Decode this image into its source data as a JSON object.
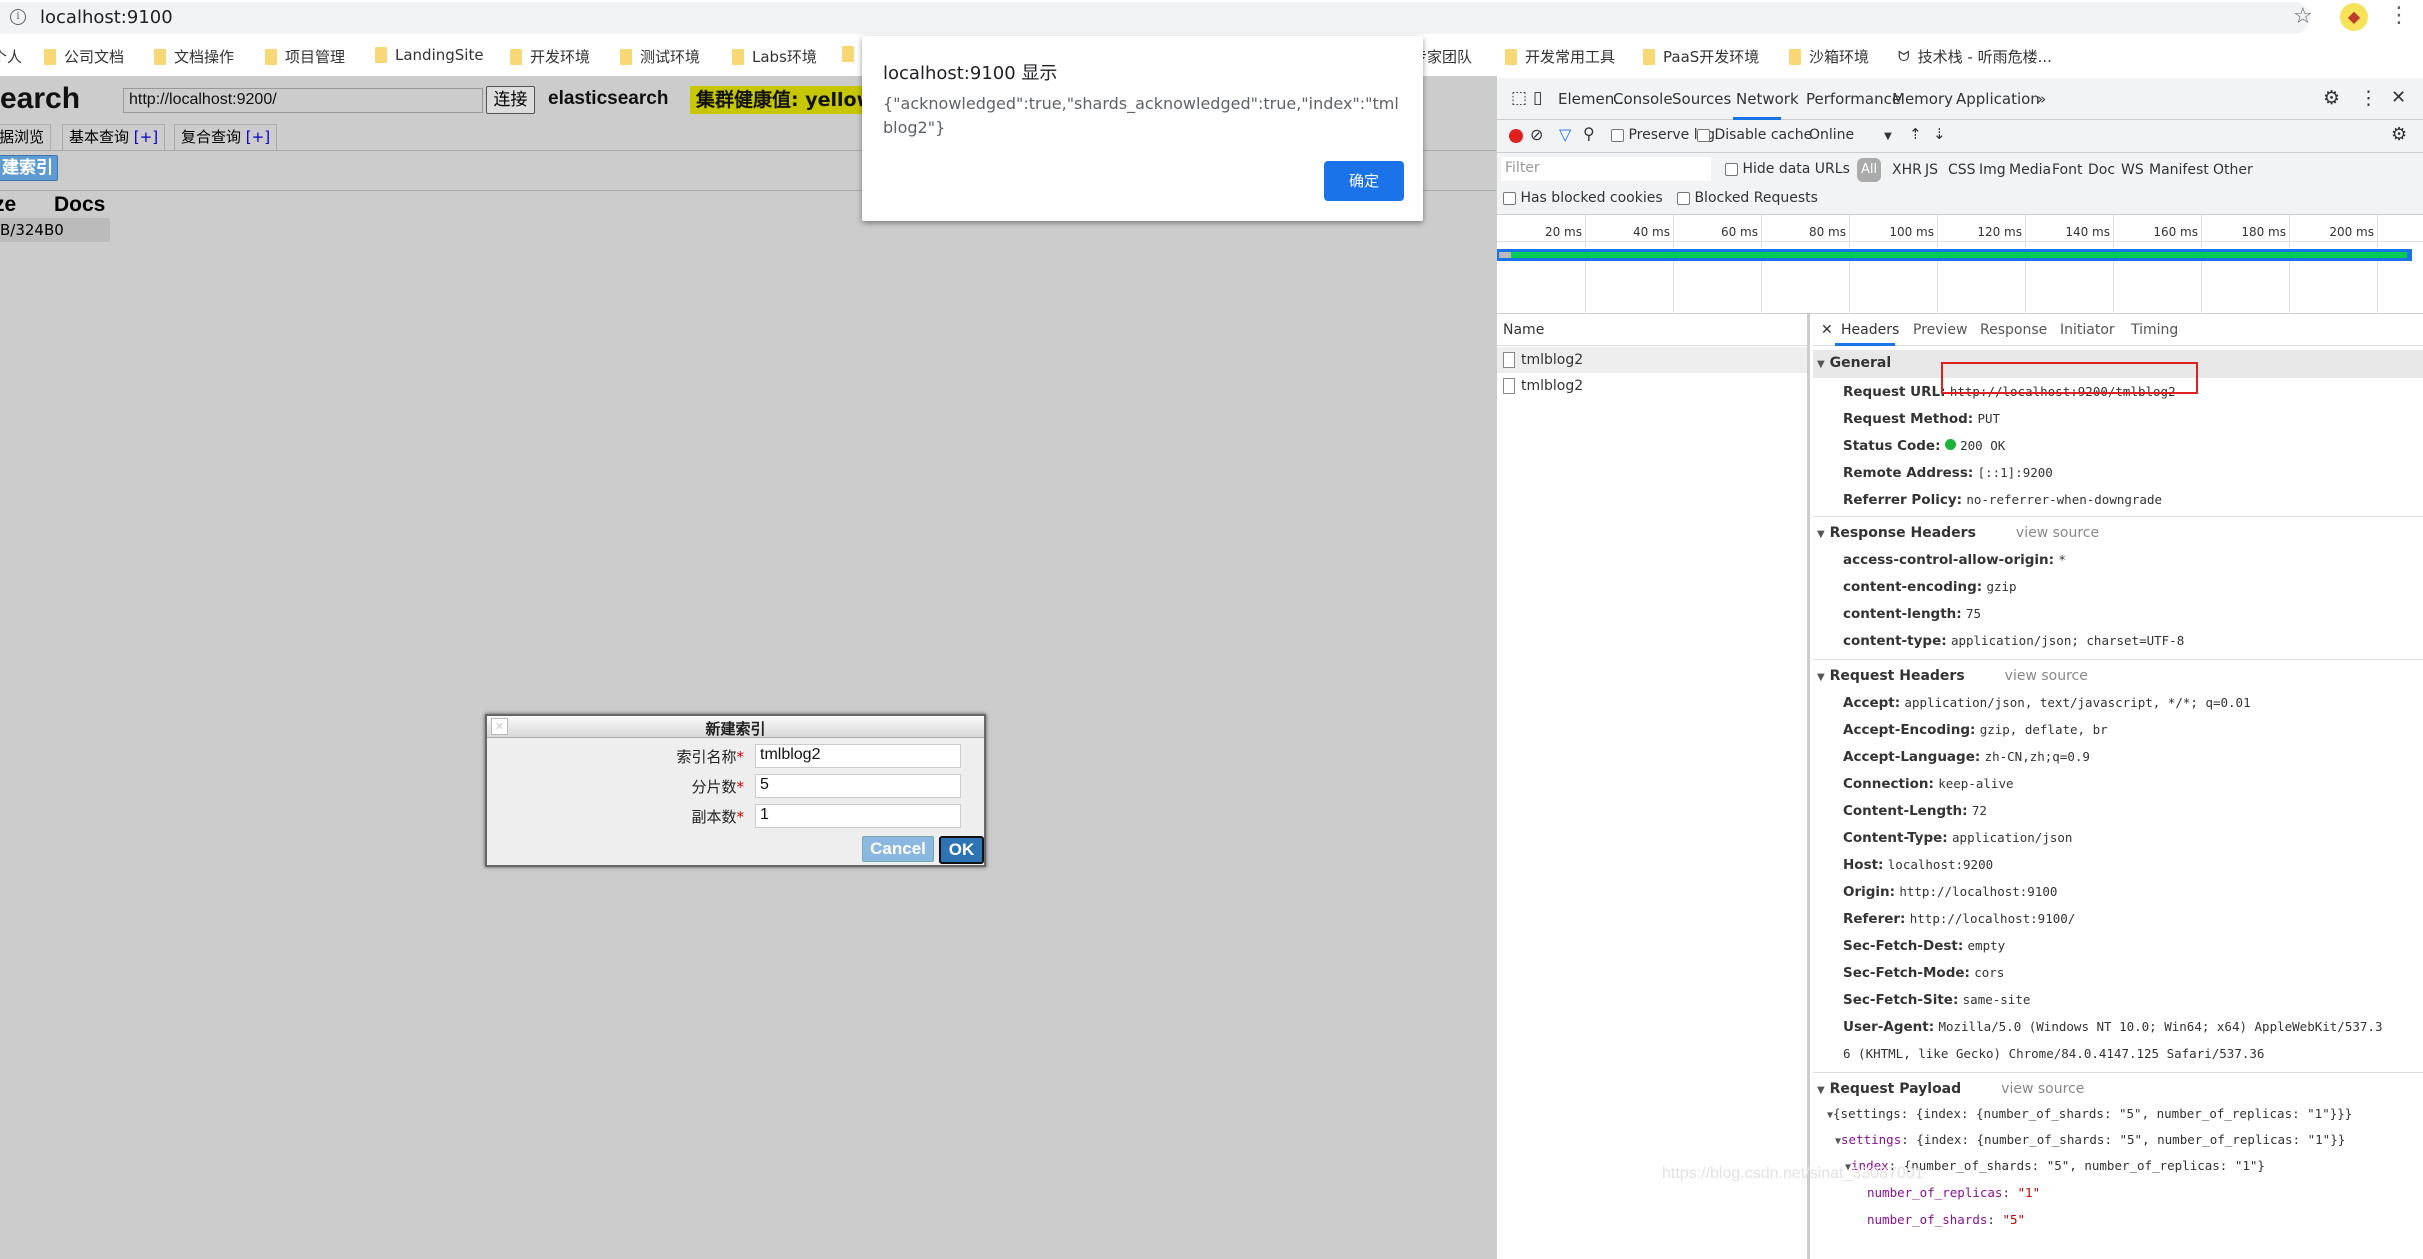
{
  "browser": {
    "address": "localhost:9100",
    "bookmarks": [
      "个人",
      "公司文档",
      "文档操作",
      "项目管理",
      "LandingSite",
      "开发环境",
      "测试环境",
      "Labs环境",
      "",
      "专家团队",
      "开发常用工具",
      "PaaS开发环境",
      "沙箱环境",
      "技术栈 - 听雨危楼..."
    ]
  },
  "es_head": {
    "title": "earch",
    "connect_url": "http://localhost:9200/",
    "connect_label": "连接",
    "cluster_name": "elasticsearch",
    "health": "集群健康值: yellow",
    "tabs": [
      {
        "label": "据浏览",
        "plus": ""
      },
      {
        "label": "基本查询 ",
        "plus": "[+]"
      },
      {
        "label": "复合查询 ",
        "plus": "[+]"
      }
    ],
    "new_index_label": "建索引",
    "col_size": "ze",
    "col_docs": "Docs",
    "row_size": "B/324B",
    "row_docs": "0"
  },
  "dialog": {
    "title": "新建索引",
    "close_glyph": "✕",
    "fields": [
      {
        "label": "索引名称",
        "value": "tmlblog2"
      },
      {
        "label": "分片数",
        "value": "5"
      },
      {
        "label": "副本数",
        "value": "1"
      }
    ],
    "required_mark": "*",
    "cancel_label": "Cancel",
    "ok_label": "OK"
  },
  "alert": {
    "title": "localhost:9100 显示",
    "message": "{\"acknowledged\":true,\"shards_acknowledged\":true,\"index\":\"tmlblog2\"}",
    "ok_label": "确定"
  },
  "devtools": {
    "tabs": [
      "Elemen...",
      "Console",
      "Sources",
      "Network",
      "Performance",
      "Memory",
      "Application",
      "»"
    ],
    "active_tab": "Network",
    "preserve_log": "Preserve log",
    "disable_cache": "Disable cache",
    "throttle": "Online",
    "filter_placeholder": "Filter",
    "hide_data_urls": "Hide data URLs",
    "type_filters": [
      "All",
      "XHR",
      "JS",
      "CSS",
      "Img",
      "Media",
      "Font",
      "Doc",
      "WS",
      "Manifest",
      "Other"
    ],
    "has_blocked_cookies": "Has blocked cookies",
    "blocked_requests": "Blocked Requests",
    "timeline_ticks": [
      "20 ms",
      "40 ms",
      "60 ms",
      "80 ms",
      "100 ms",
      "120 ms",
      "140 ms",
      "160 ms",
      "180 ms",
      "200 ms"
    ],
    "name_header": "Name",
    "requests": [
      "tmlblog2",
      "tmlblog2"
    ],
    "detail_tabs": [
      "Headers",
      "Preview",
      "Response",
      "Initiator",
      "Timing"
    ],
    "general": {
      "title": "General",
      "rows": [
        {
          "k": "Request URL:",
          "v": "http://localhost:9200/tmlblog2"
        },
        {
          "k": "Request Method:",
          "v": "PUT"
        },
        {
          "k": "Status Code:",
          "v": "200 OK"
        },
        {
          "k": "Remote Address:",
          "v": "[::1]:9200"
        },
        {
          "k": "Referrer Policy:",
          "v": "no-referrer-when-downgrade"
        }
      ]
    },
    "response_headers": {
      "title": "Response Headers",
      "view_source": "view source",
      "rows": [
        {
          "k": "access-control-allow-origin:",
          "v": "*"
        },
        {
          "k": "content-encoding:",
          "v": "gzip"
        },
        {
          "k": "content-length:",
          "v": "75"
        },
        {
          "k": "content-type:",
          "v": "application/json; charset=UTF-8"
        }
      ]
    },
    "request_headers": {
      "title": "Request Headers",
      "view_source": "view source",
      "rows": [
        {
          "k": "Accept:",
          "v": "application/json, text/javascript, */*; q=0.01"
        },
        {
          "k": "Accept-Encoding:",
          "v": "gzip, deflate, br"
        },
        {
          "k": "Accept-Language:",
          "v": "zh-CN,zh;q=0.9"
        },
        {
          "k": "Connection:",
          "v": "keep-alive"
        },
        {
          "k": "Content-Length:",
          "v": "72"
        },
        {
          "k": "Content-Type:",
          "v": "application/json"
        },
        {
          "k": "Host:",
          "v": "localhost:9200"
        },
        {
          "k": "Origin:",
          "v": "http://localhost:9100"
        },
        {
          "k": "Referer:",
          "v": "http://localhost:9100/"
        },
        {
          "k": "Sec-Fetch-Dest:",
          "v": "empty"
        },
        {
          "k": "Sec-Fetch-Mode:",
          "v": "cors"
        },
        {
          "k": "Sec-Fetch-Site:",
          "v": "same-site"
        },
        {
          "k": "User-Agent:",
          "v": "Mozilla/5.0 (Windows NT 10.0; Win64; x64) AppleWebKit/537.3"
        }
      ],
      "ua_continuation": "6 (KHTML, like Gecko) Chrome/84.0.4147.125 Safari/537.36"
    },
    "payload": {
      "title": "Request Payload",
      "view_source": "view source",
      "line1": "{settings: {index: {number_of_shards: \"5\", number_of_replicas: \"1\"}}}",
      "line2_key": "settings",
      "line2_rest": ": {index: {number_of_shards: \"5\", number_of_replicas: \"1\"}}",
      "line3_key": "index",
      "line3_rest": ": {number_of_shards: \"5\", number_of_replicas: \"1\"}",
      "replicas_key": "number_of_replicas",
      "replicas_val": "\"1\"",
      "shards_key": "number_of_shards",
      "shards_val": "\"5\""
    },
    "watermark": "https://blog.csdn.net/sinat_33087001"
  }
}
